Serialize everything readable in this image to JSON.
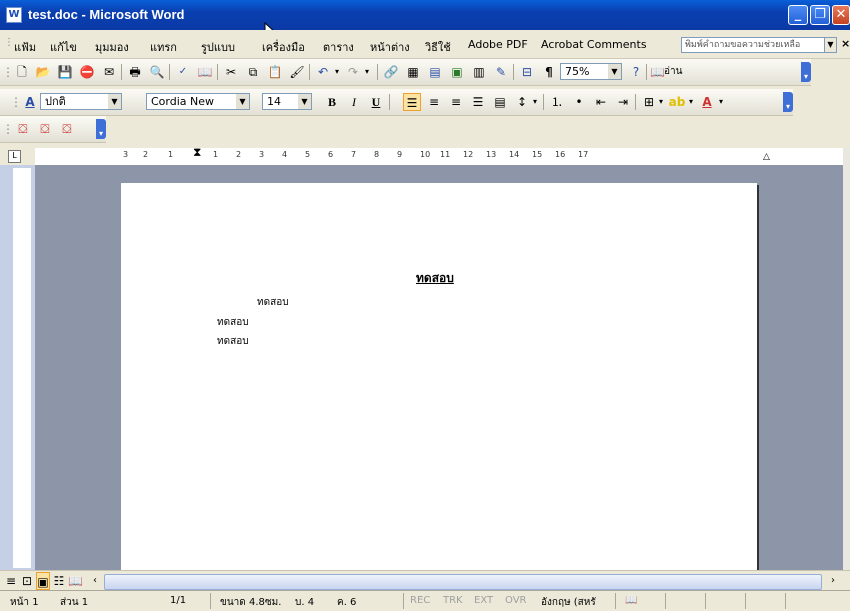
{
  "window": {
    "title": "test.doc - Microsoft Word"
  },
  "menu": [
    "แฟ้ม",
    "แก้ไข",
    "มุมมอง",
    "แทรก",
    "รูปแบบ",
    "เครื่องมือ",
    "ตาราง",
    "หน้าต่าง",
    "วิธีใช้",
    "Adobe PDF",
    "Acrobat Comments"
  ],
  "help_box": {
    "placeholder": "พิมพ์คำถามขอความช่วยเหลือ"
  },
  "standard_toolbar": {
    "zoom": "75%",
    "read_label": "อ่าน"
  },
  "format_toolbar": {
    "style": "ปกติ",
    "font": "Cordia New",
    "size": "14",
    "bold": "B",
    "italic": "I",
    "underline": "U"
  },
  "ruler": {
    "h_ticks": [
      "3",
      "2",
      "1",
      "1",
      "2",
      "3",
      "4",
      "5",
      "6",
      "7",
      "8",
      "9",
      "10",
      "11",
      "12",
      "13",
      "14",
      "15",
      "16",
      "17"
    ]
  },
  "document": {
    "heading": "ทดสอบ",
    "lines": [
      "ทดสอบ",
      "ทดสอบ",
      "ทดสอบ"
    ]
  },
  "status": {
    "page": "หน้า 1",
    "section": "ส่วน 1",
    "page_count": "1/1",
    "at": "ขนาด 4.8ซม.",
    "line": "บ. 4",
    "col": "ค. 6",
    "rec": "REC",
    "trk": "TRK",
    "ext": "EXT",
    "ovr": "OVR",
    "language": "อังกฤษ (สหรั"
  }
}
